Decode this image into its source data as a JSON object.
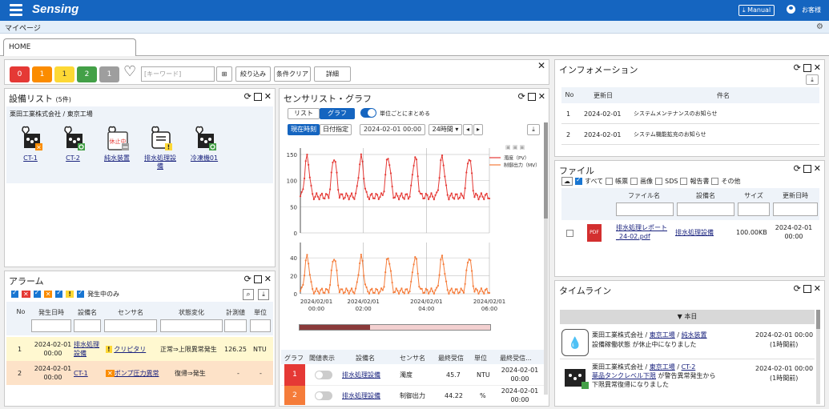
{
  "header": {
    "logo": "Sensing",
    "manual": "Manual",
    "user": "お客様"
  },
  "subbar": {
    "title": "マイページ"
  },
  "tabs": [
    "HOME"
  ],
  "filter": {
    "badges": [
      {
        "count": "0",
        "color": "#e53935"
      },
      {
        "count": "1",
        "color": "#fb8c00"
      },
      {
        "count": "1",
        "color": "#fdd835"
      },
      {
        "count": "2",
        "color": "#43a047"
      },
      {
        "count": "1",
        "color": "#9e9e9e"
      }
    ],
    "keyword_placeholder": "[キーワード]",
    "narrow": "絞り込み",
    "clear": "条件クリア",
    "detail": "詳細"
  },
  "equipment": {
    "title": "設備リスト",
    "count": "(5件)",
    "company": "栗田工業株式会社 / 東京工場",
    "items": [
      {
        "label": "CT-1"
      },
      {
        "label": "CT-2"
      },
      {
        "label": "純水装置",
        "status": "休止中"
      },
      {
        "label": "排水処理設備"
      },
      {
        "label": "冷凍機01"
      }
    ]
  },
  "alarm": {
    "title": "アラーム",
    "active_only": "発生中のみ",
    "headers": [
      "No",
      "発生日時",
      "設備名",
      "センサ名",
      "状態変化",
      "計測値",
      "単位"
    ],
    "rows": [
      {
        "no": "1",
        "datetime": "2024-02-01 00:00",
        "equipment": "排水処理設備",
        "sensor": "クリピタリ",
        "change": "正常⇒上限異常発生",
        "value": "126.25",
        "unit": "NTU",
        "bg": "#fff8d0"
      },
      {
        "no": "2",
        "datetime": "2024-02-01 00:00",
        "equipment": "CT-1",
        "sensor": "ポンプ圧力異常",
        "change": "復帰⇒発生",
        "value": "-",
        "unit": "-",
        "bg": "#fde2c8"
      }
    ]
  },
  "sensor": {
    "title": "センサリスト・グラフ",
    "tab_list": "リスト",
    "tab_graph": "グラフ",
    "group_label": "単位ごとにまとめる",
    "now": "現在時刻",
    "date_spec": "日付指定",
    "date_value": "2024-02-01 00:00",
    "range": "24時間",
    "legend": [
      "濁度（PV）",
      "制御出力（MV）"
    ],
    "table_headers": [
      "グラフ",
      "閾値表示",
      "設備名",
      "センサ名",
      "最終受信",
      "単位",
      "最終受信..."
    ],
    "rows": [
      {
        "no": "1",
        "color": "#e53935",
        "equipment": "排水処理設備",
        "sensor": "濁度",
        "value": "45.7",
        "unit": "NTU",
        "time": "2024-02-01 00:00"
      },
      {
        "no": "2",
        "color": "#f57c3a",
        "equipment": "排水処理設備",
        "sensor": "制御出力",
        "value": "44.22",
        "unit": "%",
        "time": "2024-02-01 00:00"
      }
    ]
  },
  "chart_data": [
    {
      "type": "line",
      "series": [
        {
          "name": "濁度（PV）",
          "color": "#e53935"
        }
      ],
      "x": [
        "2024/02/01 00:00",
        "2024/02/01 02:00",
        "2024/02/01 04:00",
        "2024/02/01 06:00"
      ],
      "yticks": [
        "0",
        "50",
        "100",
        "150"
      ],
      "ylim": [
        0,
        150
      ]
    },
    {
      "type": "line",
      "series": [
        {
          "name": "制御出力（MV）",
          "color": "#f57c3a"
        }
      ],
      "x": [
        "2024/02/01 00:00",
        "2024/02/01 02:00",
        "2024/02/01 04:00",
        "2024/02/01 06:00"
      ],
      "yticks": [
        "0",
        "20",
        "40"
      ],
      "ylim": [
        0,
        50
      ]
    }
  ],
  "info": {
    "title": "インフォメーション",
    "headers": [
      "No",
      "更新日",
      "件名"
    ],
    "rows": [
      {
        "no": "1",
        "date": "2024-02-01",
        "subject": "システムメンテナンスのお知らせ"
      },
      {
        "no": "2",
        "date": "2024-02-01",
        "subject": "システム機能拡充のお知らせ"
      }
    ]
  },
  "files": {
    "title": "ファイル",
    "filters": [
      "すべて",
      "帳票",
      "画像",
      "SDS",
      "報告書",
      "その他"
    ],
    "headers": [
      "ファイル名",
      "設備名",
      "サイズ",
      "更新日時"
    ],
    "rows": [
      {
        "name": "排水処理レポート_24-02.pdf",
        "equipment": "排水処理設備",
        "size": "100.00KB",
        "date": "2024-02-01 00:00"
      }
    ]
  },
  "timeline": {
    "title": "タイムライン",
    "today": "本日",
    "items": [
      {
        "company": "栗田工業株式会社",
        "site": "東京工場",
        "equip": "純水装置",
        "msg": "設備稼働状態 が休止中になりました",
        "date": "2024-02-01 00:00",
        "ago": "(1時間前)"
      },
      {
        "company": "栗田工業株式会社",
        "site": "東京工場",
        "equip": "CT-2",
        "sensor": "薬品タンクレベル下限",
        "msg2": "が警告異常発生から",
        "msg3": "下限異常復帰になりました",
        "date": "2024-02-01 00:00",
        "ago": "(1時間前)"
      }
    ]
  }
}
